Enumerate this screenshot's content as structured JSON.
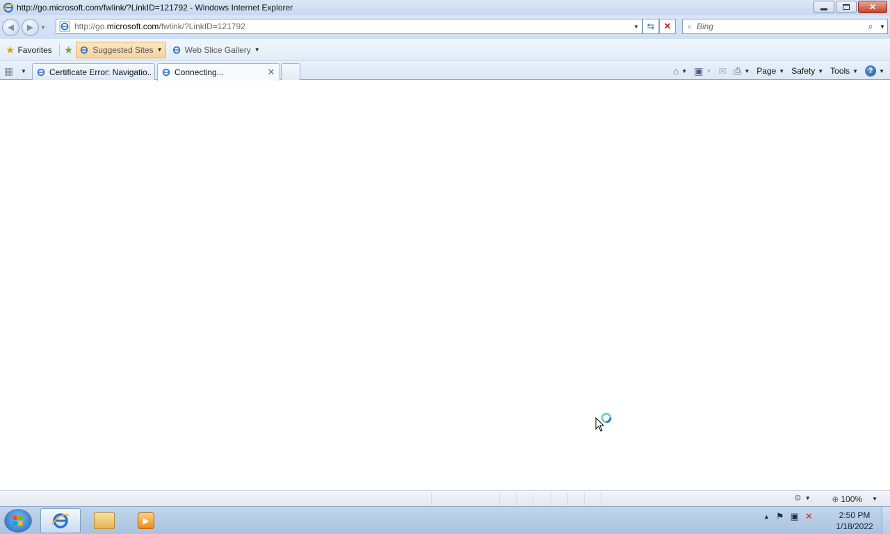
{
  "window": {
    "title": "http://go.microsoft.com/fwlink/?LinkID=121792 - Windows Internet Explorer",
    "controls": {
      "minimize": "minimize",
      "maximize": "restore",
      "close": "close"
    }
  },
  "address_bar": {
    "url_prefix": "http://go.",
    "url_domain": "microsoft.com",
    "url_suffix": "/fwlink/?LinkID=121792"
  },
  "search": {
    "placeholder": "Bing"
  },
  "favorites_bar": {
    "favorites_label": "Favorites",
    "suggested_sites_label": "Suggested Sites",
    "web_slice_gallery_label": "Web Slice Gallery"
  },
  "tabs": [
    {
      "label": "Certificate Error: Navigatio...",
      "active": false
    },
    {
      "label": "Connecting...",
      "active": true
    }
  ],
  "command_bar": {
    "page_label": "Page",
    "safety_label": "Safety",
    "tools_label": "Tools"
  },
  "status_bar": {
    "zoom": "100%"
  },
  "taskbar": {
    "time": "2:50 PM",
    "date": "1/18/2022",
    "apps": [
      "internet-explorer",
      "windows-explorer",
      "media-player"
    ]
  },
  "icons": {
    "ie": "internet-explorer-icon",
    "home": "home-icon",
    "feeds": "rss-feed-icon",
    "mail": "read-mail-icon",
    "print": "printer-icon",
    "help": "help-icon"
  }
}
